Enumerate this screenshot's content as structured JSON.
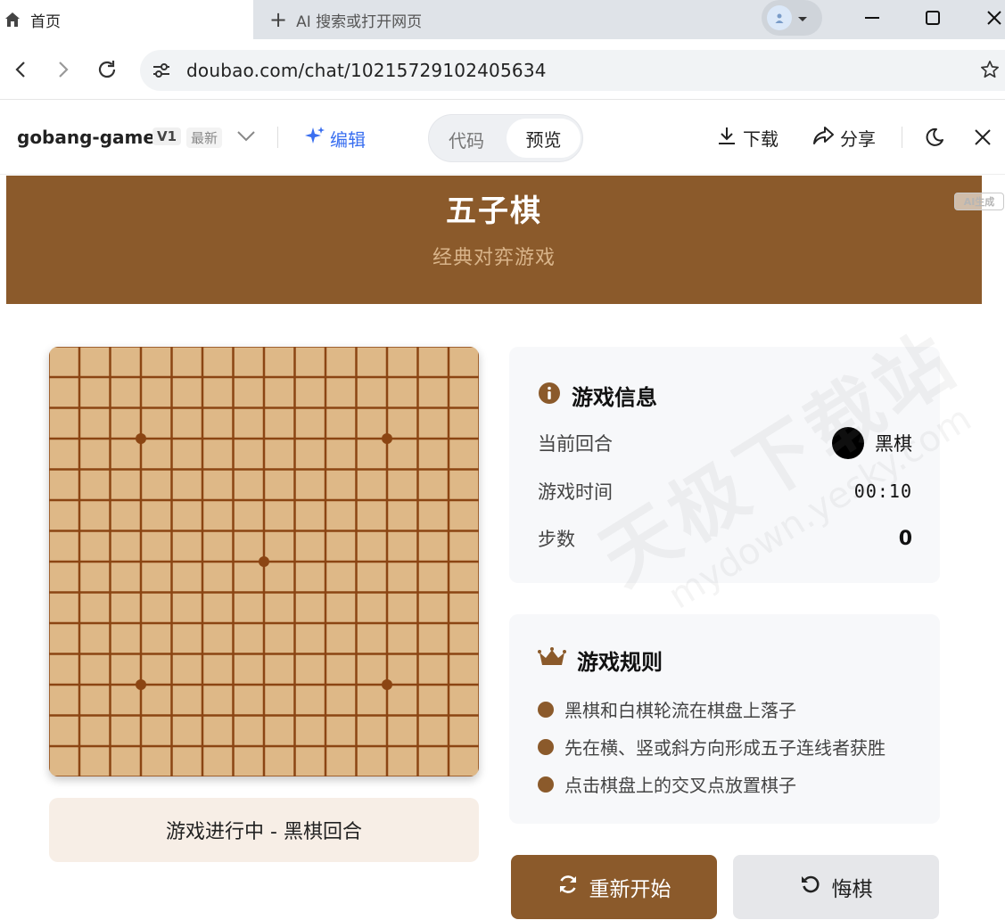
{
  "browser": {
    "tab_title": "首页",
    "new_tab_label": "AI 搜索或打开网页",
    "url": "doubao.com/chat/10215729102405634"
  },
  "app_header": {
    "app_name": "gobang-game",
    "version": "V1",
    "latest_badge": "最新",
    "edit_label": "编辑",
    "code_tab": "代码",
    "preview_tab": "预览",
    "download_label": "下载",
    "share_label": "分享"
  },
  "game": {
    "title": "五子棋",
    "subtitle": "经典对弈游戏",
    "ai_badge": "AI生成",
    "status_text": "游戏进行中 - 黑棋回合",
    "board": {
      "size": 15,
      "star_points": [
        [
          3,
          3
        ],
        [
          11,
          3
        ],
        [
          7,
          7
        ],
        [
          3,
          11
        ],
        [
          11,
          11
        ]
      ],
      "color": "#deb887",
      "line_color": "#8b4513"
    },
    "info": {
      "heading": "游戏信息",
      "current_turn_label": "当前回合",
      "current_turn_value": "黑棋",
      "time_label": "游戏时间",
      "time_value": "00:10",
      "steps_label": "步数",
      "steps_value": "0"
    },
    "rules": {
      "heading": "游戏规则",
      "items": [
        "黑棋和白棋轮流在棋盘上落子",
        "先在横、竖或斜方向形成五子连线者获胜",
        "点击棋盘上的交叉点放置棋子"
      ]
    },
    "buttons": {
      "restart": "重新开始",
      "undo": "悔棋"
    }
  },
  "watermark": {
    "text": "天极下载站",
    "url": "mydown.yesky.com"
  },
  "colors": {
    "brand": "#8b5a2b",
    "accent_blue": "#3a6ff0"
  }
}
